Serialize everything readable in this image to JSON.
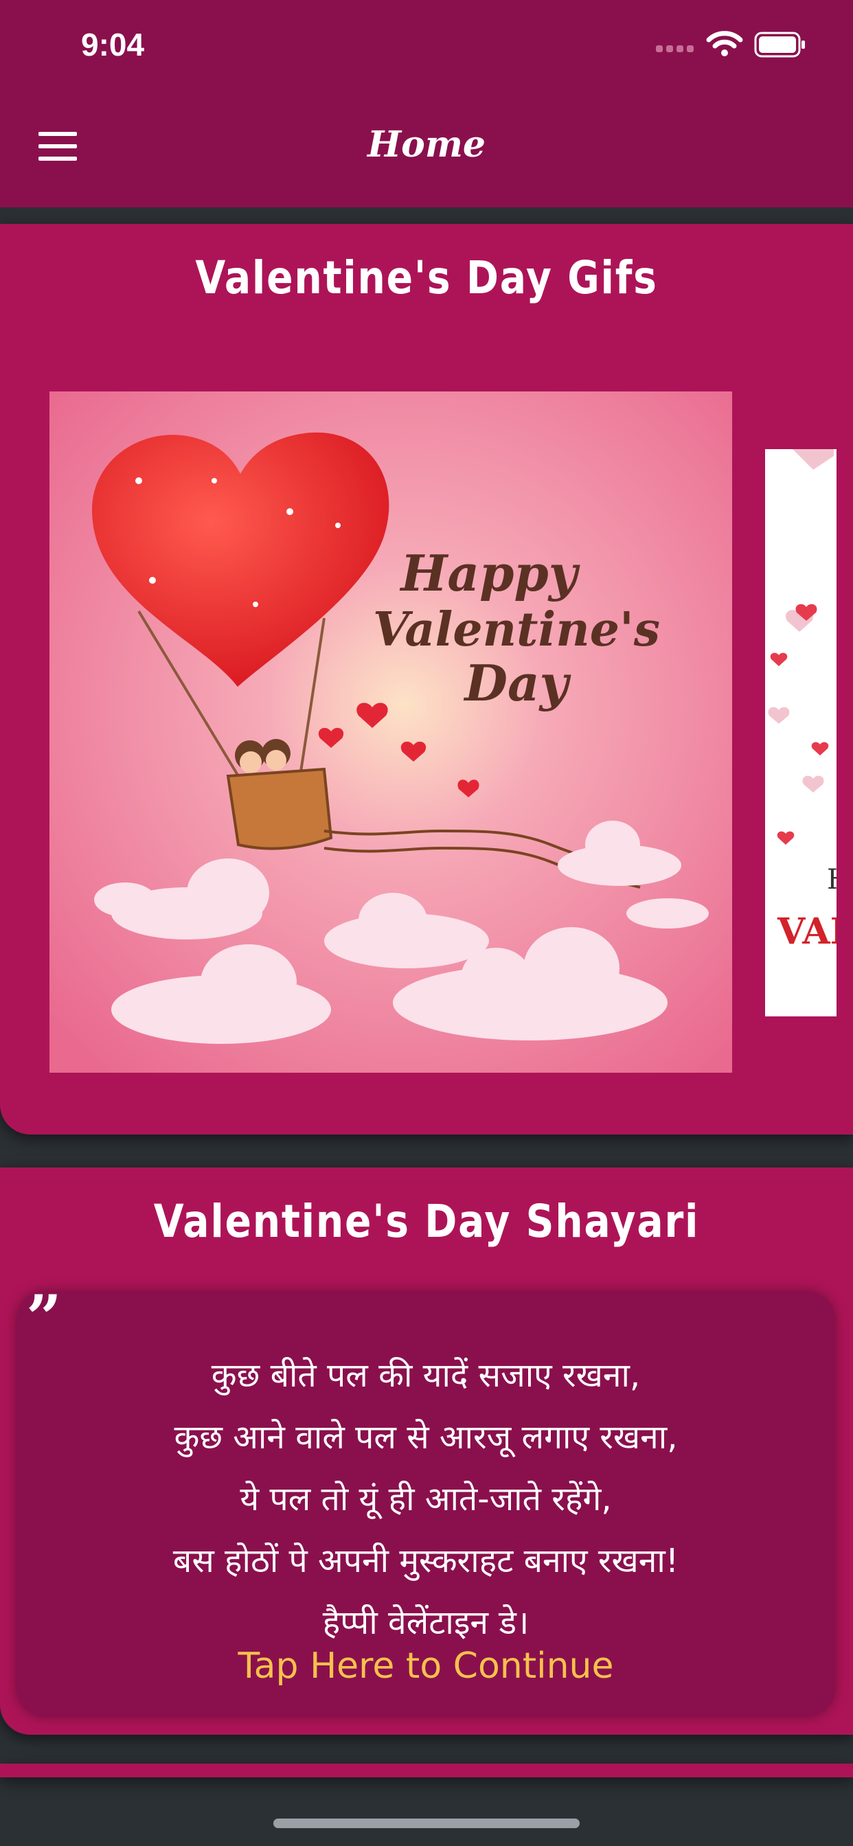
{
  "status_bar": {
    "time": "9:04"
  },
  "header": {
    "title": "Home",
    "menu_icon": "hamburger-menu-icon"
  },
  "gifs_section": {
    "title": "Valentine's Day Gifs",
    "cards": [
      {
        "text_line1": "Happy",
        "text_line2": "Valentine's",
        "text_line3": "Day"
      },
      {
        "text_line1": "H",
        "text_line2": "VAL"
      }
    ]
  },
  "shayari_section": {
    "title": "Valentine's Day Shayari",
    "quote_icon": "quote-icon",
    "lines": [
      "कुछ बीते पल की यादें सजाए रखना,",
      "कुछ आने वाले पल से आरजू लगाए रखना,",
      "ये पल तो यूं ही आते-जाते रहेंगे,",
      "बस होठों पे अपनी मुस्कराहट बनाए रखना!",
      "हैप्पी वेलेंटाइन डे।"
    ],
    "cta": "Tap Here to Continue"
  },
  "colors": {
    "primary": "#8a104d",
    "card": "#ad1457",
    "accent": "#f6c14c",
    "background": "#2b3035"
  }
}
